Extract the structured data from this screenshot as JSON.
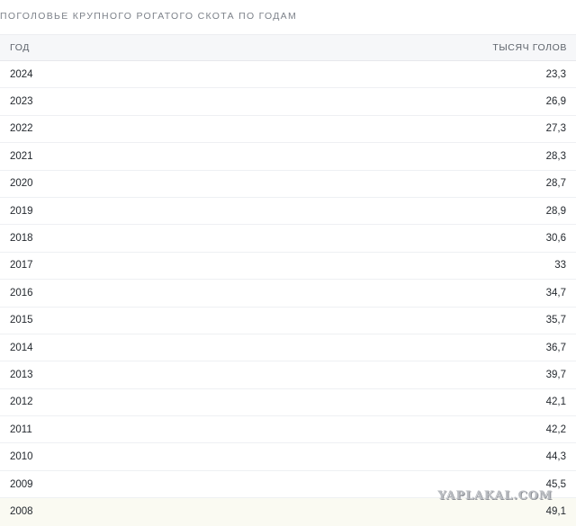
{
  "caption": "ПОГОЛОВЬЕ КРУПНОГО РОГАТОГО СКОТА ПО ГОДАМ",
  "table": {
    "headers": {
      "year": "ГОД",
      "value": "ТЫСЯЧ ГОЛОВ"
    },
    "rows": [
      {
        "year": "2024",
        "value": "23,3"
      },
      {
        "year": "2023",
        "value": "26,9"
      },
      {
        "year": "2022",
        "value": "27,3"
      },
      {
        "year": "2021",
        "value": "28,3"
      },
      {
        "year": "2020",
        "value": "28,7"
      },
      {
        "year": "2019",
        "value": "28,9"
      },
      {
        "year": "2018",
        "value": "30,6"
      },
      {
        "year": "2017",
        "value": "33"
      },
      {
        "year": "2016",
        "value": "34,7"
      },
      {
        "year": "2015",
        "value": "35,7"
      },
      {
        "year": "2014",
        "value": "36,7"
      },
      {
        "year": "2013",
        "value": "39,7"
      },
      {
        "year": "2012",
        "value": "42,1"
      },
      {
        "year": "2011",
        "value": "42,2"
      },
      {
        "year": "2010",
        "value": "44,3"
      },
      {
        "year": "2009",
        "value": "45,5"
      },
      {
        "year": "2008",
        "value": "49,1"
      }
    ]
  },
  "watermark": "YAPLAKAL.COM"
}
